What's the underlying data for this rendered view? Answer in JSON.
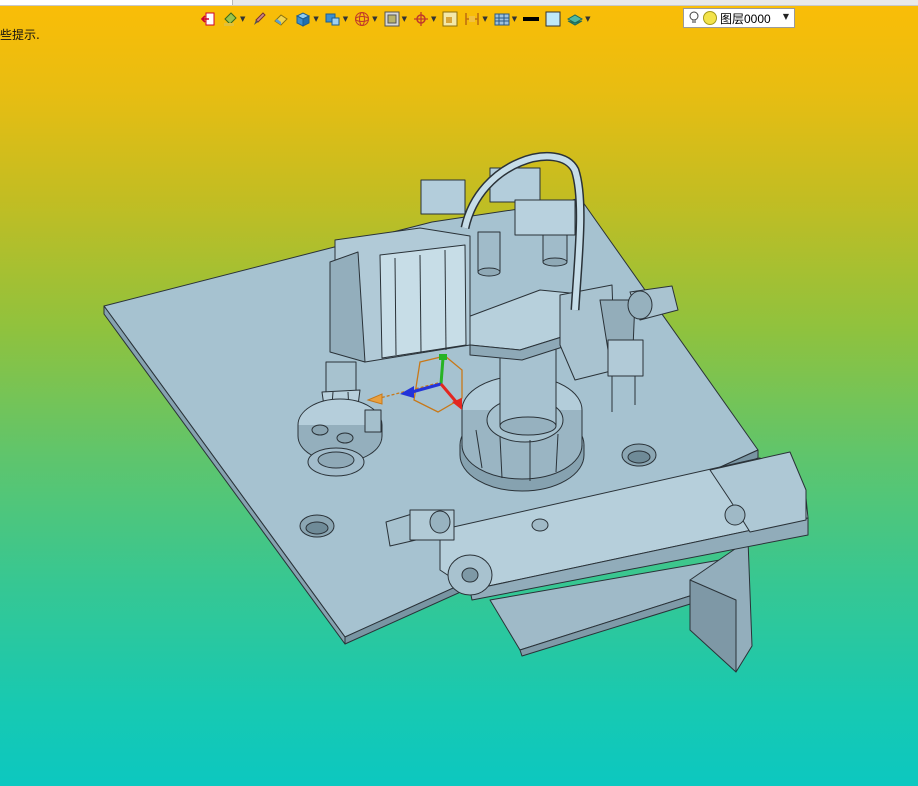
{
  "hint": {
    "text": "些提示."
  },
  "layer": {
    "name": "图层0000"
  },
  "toolbar": {
    "icons": [
      "exit-icon",
      "paint-bucket-icon",
      "brush-icon",
      "eraser-icon",
      "shaded-cube-icon",
      "display-style-icon",
      "wireframe-sphere-icon",
      "view-frame-icon",
      "snap-target-icon",
      "box-select-icon",
      "fit-dimension-icon",
      "grid-icon",
      "line-color-icon",
      "fill-color-icon",
      "layers-icon"
    ]
  },
  "colors": {
    "gradient_top": "#fbbd06",
    "gradient_bottom": "#0cc8c0",
    "model_fill": "#a9c4d2",
    "model_edge": "#2a3238",
    "axis_x": "#e32620",
    "axis_y": "#27b324",
    "axis_z": "#2333d9",
    "triad_orange": "#c87818"
  }
}
